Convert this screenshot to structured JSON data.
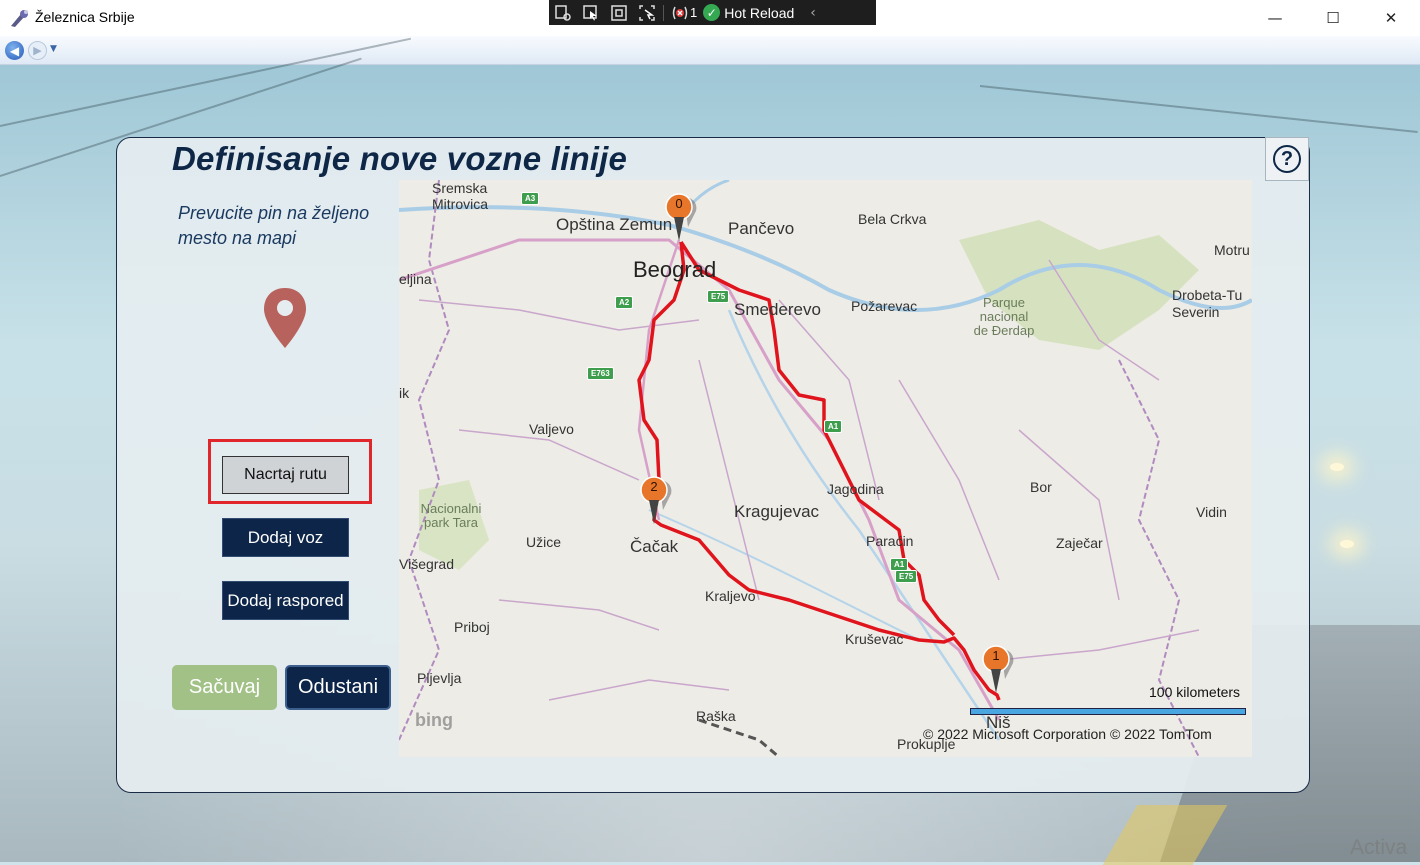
{
  "window": {
    "title": "Železnica Srbije",
    "minimize_glyph": "—",
    "maximize_glyph": "☐",
    "close_glyph": "✕"
  },
  "debug_toolbar": {
    "error_count": "1",
    "hot_reload_label": "Hot Reload"
  },
  "page": {
    "title": "Definisanje nove vozne linije",
    "help_label": "?",
    "instruction": "Prevucite pin na željeno mesto na mapi",
    "pin_color": "#b8625e"
  },
  "buttons": {
    "draw_route": "Nacrtaj rutu",
    "add_train": "Dodaj voz",
    "add_schedule": "Dodaj raspored",
    "save": "Sačuvaj",
    "cancel": "Odustani"
  },
  "map": {
    "route_color": "#e0141c",
    "pin_color": "#e8762a",
    "pins": [
      "0",
      "1",
      "2"
    ],
    "places": {
      "sremska_mitrovica": "Sremska Mitrovica",
      "opstina_zemun": "Opština Zemun",
      "pancevo": "Pančevo",
      "beograd": "Beograd",
      "bela_crkva": "Bela Crkva",
      "motru": "Motru",
      "smederevo": "Smederevo",
      "pozarevac": "Požarevac",
      "park_djerdap": "Parque nacional de Đerdap",
      "drobeta": "Drobeta-Tu Severin",
      "ljina": "eljina",
      "valjevo": "Valjevo",
      "ik": "ik",
      "jagodina": "Jagodina",
      "bor": "Bor",
      "kragujevac": "Kragujevac",
      "vidin": "Vidin",
      "nac_park_tara": "Nacionalni park Tara",
      "uzice": "Užice",
      "cacak": "Čačak",
      "paracin": "Paraćin",
      "zajecar": "Zaječar",
      "visegrad": "Višegrad",
      "kraljevo": "Kraljevo",
      "priboj": "Priboj",
      "krusevac": "Kruševac",
      "pljevlja": "Pljevlja",
      "raska": "Raška",
      "nis": "Niš",
      "prokuplje": "Prokuplje"
    },
    "road_shields": [
      "A3",
      "A1",
      "A2",
      "E75",
      "E763",
      "A1",
      "E75"
    ],
    "scale_label": "100 kilometers",
    "copyright": "© 2022 Microsoft Corporation   © 2022 TomTom",
    "provider": "bing"
  },
  "watermark": "Activa"
}
